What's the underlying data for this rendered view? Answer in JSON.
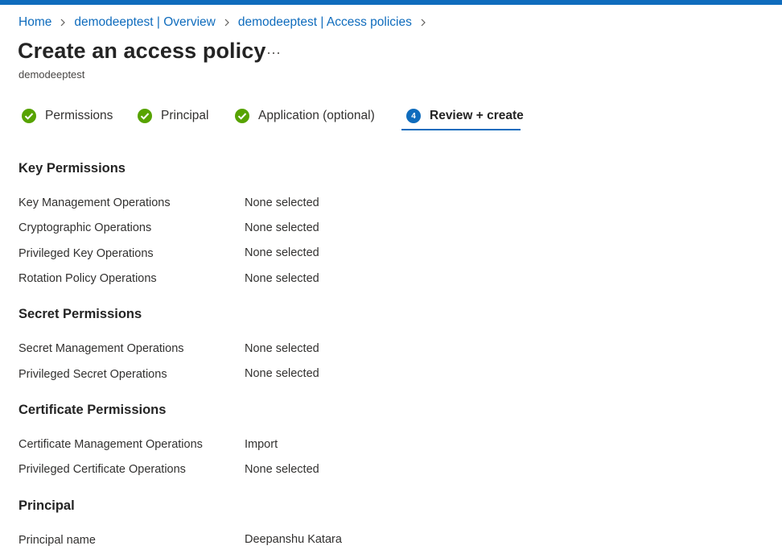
{
  "colors": {
    "accent": "#0f6cbd",
    "success": "#57a300",
    "text": "#323130"
  },
  "breadcrumb": [
    {
      "label": "Home"
    },
    {
      "label": "demodeeptest | Overview"
    },
    {
      "label": "demodeeptest | Access policies"
    }
  ],
  "header": {
    "title": "Create an access policy",
    "subtitle": "demodeeptest",
    "more_icon": "ellipsis-icon"
  },
  "tabs": [
    {
      "label": "Permissions",
      "status": "complete",
      "icon": "checkmark-circle-icon"
    },
    {
      "label": "Principal",
      "status": "complete",
      "icon": "checkmark-circle-icon"
    },
    {
      "label": "Application (optional)",
      "status": "complete",
      "icon": "checkmark-circle-icon"
    },
    {
      "label": "Review + create",
      "status": "active",
      "step": "4"
    }
  ],
  "sections": {
    "key": {
      "title": "Key Permissions",
      "rows": [
        {
          "label": "Key Management Operations",
          "value": "None selected"
        },
        {
          "label": "Cryptographic Operations",
          "value": "None selected"
        },
        {
          "label": "Privileged Key Operations",
          "value": "None selected"
        },
        {
          "label": "Rotation Policy Operations",
          "value": "None selected"
        }
      ]
    },
    "secret": {
      "title": "Secret Permissions",
      "rows": [
        {
          "label": "Secret Management Operations",
          "value": "None selected"
        },
        {
          "label": "Privileged Secret Operations",
          "value": "None selected"
        }
      ]
    },
    "certificate": {
      "title": "Certificate Permissions",
      "rows": [
        {
          "label": "Certificate Management Operations",
          "value": "Import"
        },
        {
          "label": "Privileged Certificate Operations",
          "value": "None selected"
        }
      ]
    },
    "principal": {
      "title": "Principal",
      "rows": [
        {
          "label": "Principal name",
          "value": "Deepanshu Katara"
        }
      ]
    }
  }
}
